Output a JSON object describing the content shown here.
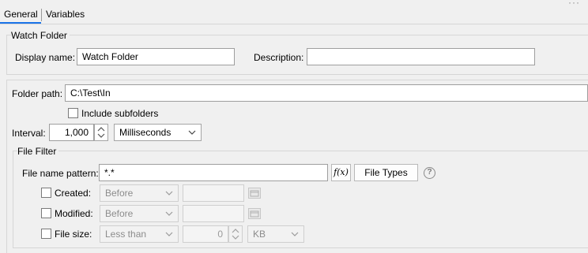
{
  "tabs": [
    {
      "label": "General",
      "active": true
    },
    {
      "label": "Variables",
      "active": false
    }
  ],
  "more_icon": "···",
  "accent_color": "#1a73e8",
  "watch_folder_group": {
    "title": "Watch Folder",
    "display_name_label": "Display name:",
    "display_name_value": "Watch Folder",
    "description_label": "Description:",
    "description_value": ""
  },
  "settings": {
    "folder_path_label": "Folder path:",
    "folder_path_value": "C:\\Test\\In",
    "include_subfolders_label": "Include subfolders",
    "include_subfolders_checked": false,
    "interval_label": "Interval:",
    "interval_value": "1,000",
    "interval_unit": "Milliseconds"
  },
  "file_filter": {
    "title": "File Filter",
    "pattern_label": "File name pattern:",
    "pattern_value": "*.*",
    "fx_label": "f(x)",
    "file_types_button": "File Types",
    "help_icon": "?",
    "created_label": "Created:",
    "created_mode": "Before",
    "created_date": "",
    "modified_label": "Modified:",
    "modified_mode": "Before",
    "modified_date": "",
    "size_label": "File size:",
    "size_mode": "Less than",
    "size_value": "0",
    "size_unit": "KB"
  }
}
